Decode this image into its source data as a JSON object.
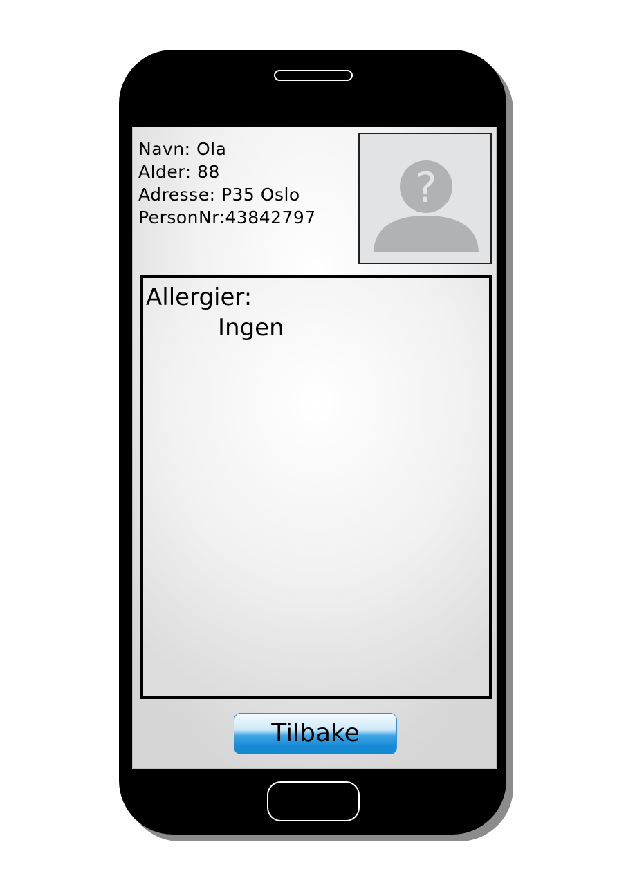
{
  "patient": {
    "name_line": "Navn: Ola",
    "age_line": "Alder: 88",
    "address_line": "Adresse: P35 Oslo",
    "person_nr_line": "PersonNr:43842797"
  },
  "avatar": {
    "icon": "unknown-person-icon"
  },
  "allergies": {
    "title": "Allergier:",
    "value": "Ingen"
  },
  "actions": {
    "back_label": "Tilbake"
  },
  "colors": {
    "phone_body": "#000000",
    "button_accent": "#1a8ad6",
    "avatar_silhouette": "#b0b3b5"
  }
}
